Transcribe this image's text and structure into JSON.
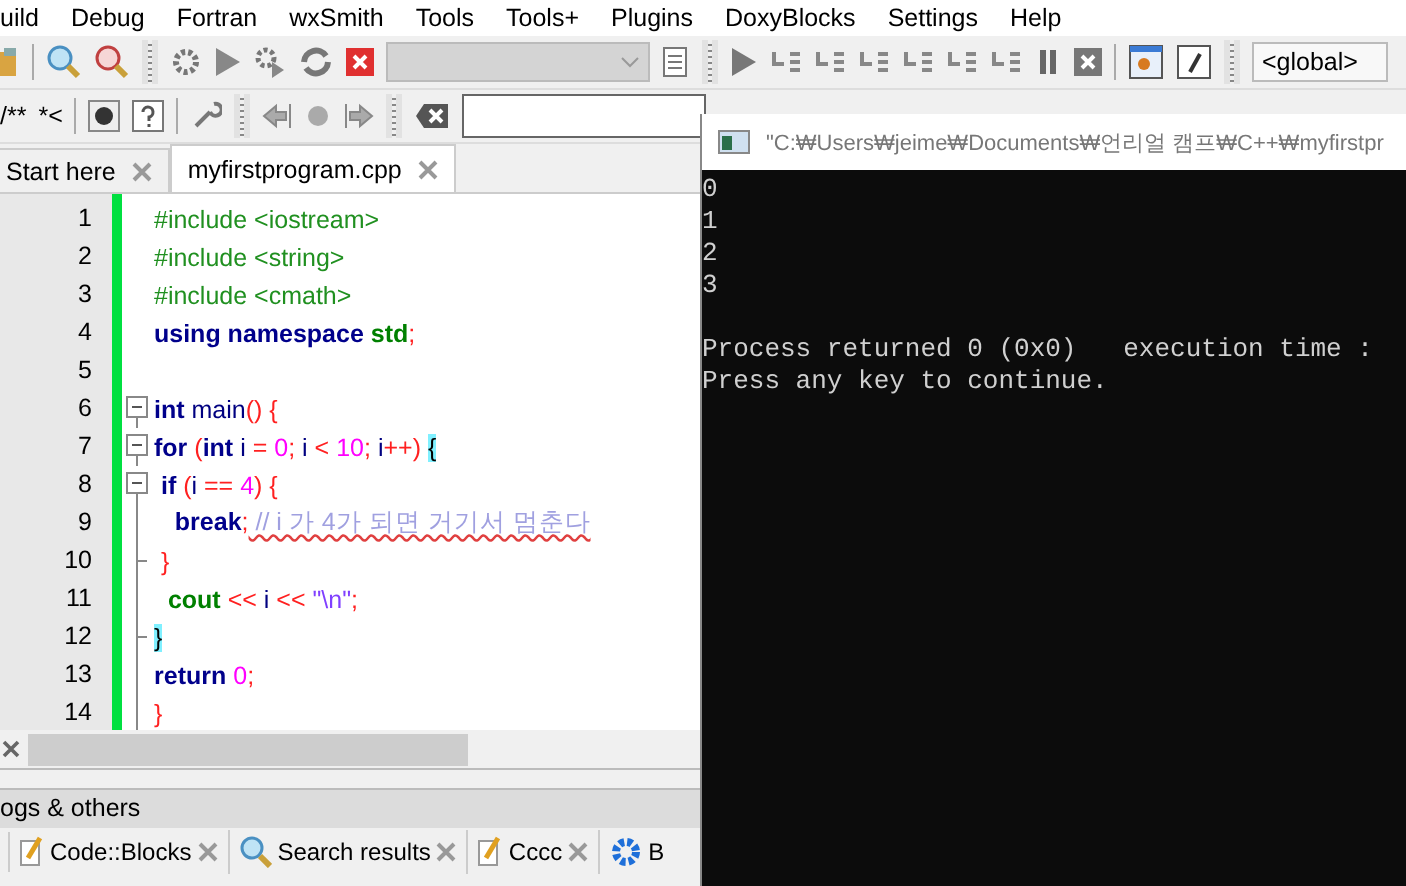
{
  "menu": [
    "uild",
    "Debug",
    "Fortran",
    "wxSmith",
    "Tools",
    "Tools+",
    "Plugins",
    "DoxyBlocks",
    "Settings",
    "Help"
  ],
  "target_dropdown": {
    "disabled": true
  },
  "scope_dropdown": {
    "value": "<global>"
  },
  "comment_buttons": [
    "/**",
    "*<"
  ],
  "editor_tabs": [
    {
      "label": "Start here",
      "selected": false
    },
    {
      "label": "myfirstprogram.cpp",
      "selected": true
    }
  ],
  "code_lines": [
    {
      "number": "1",
      "kind": "plain",
      "tokens": [
        {
          "kind": "preproc",
          "text": "#include <iostream>"
        }
      ]
    },
    {
      "number": "2",
      "kind": "plain",
      "tokens": [
        {
          "kind": "preproc",
          "text": "#include <string>"
        }
      ]
    },
    {
      "number": "3",
      "kind": "plain",
      "tokens": [
        {
          "kind": "preproc",
          "text": "#include <cmath>"
        }
      ]
    },
    {
      "number": "4",
      "kind": "plain",
      "tokens": [
        {
          "kind": "keyword",
          "text": "using namespace "
        },
        {
          "kind": "std",
          "text": "std"
        },
        {
          "kind": "op",
          "text": ";"
        }
      ]
    },
    {
      "number": "5",
      "kind": "plain"
    },
    {
      "number": "6",
      "kind": "fold-start",
      "tokens": [
        {
          "kind": "keyword",
          "text": "int"
        },
        {
          "kind": "plain",
          "text": " main"
        },
        {
          "kind": "op",
          "text": "() {"
        }
      ]
    },
    {
      "number": "7",
      "kind": "fold-start",
      "tokens": [
        {
          "kind": "keyword",
          "text": "for"
        },
        {
          "kind": "op",
          "text": " ("
        },
        {
          "kind": "keyword",
          "text": "int"
        },
        {
          "kind": "plain",
          "text": " i "
        },
        {
          "kind": "op",
          "text": "="
        },
        {
          "kind": "number",
          "text": " 0"
        },
        {
          "kind": "op",
          "text": ";"
        },
        {
          "kind": "plain",
          "text": " i "
        },
        {
          "kind": "op",
          "text": "<"
        },
        {
          "kind": "number",
          "text": " 10"
        },
        {
          "kind": "op",
          "text": ";"
        },
        {
          "kind": "plain",
          "text": " i"
        },
        {
          "kind": "op",
          "text": "++) "
        },
        {
          "kind": "brace",
          "text": "{"
        }
      ]
    },
    {
      "number": "8",
      "kind": "fold-start",
      "tokens": [
        {
          "kind": "keyword",
          "text": " if"
        },
        {
          "kind": "op",
          "text": " ("
        },
        {
          "kind": "plain",
          "text": "i "
        },
        {
          "kind": "op",
          "text": "=="
        },
        {
          "kind": "number",
          "text": " 4"
        },
        {
          "kind": "op",
          "text": ") {"
        }
      ]
    },
    {
      "number": "9",
      "kind": "fold-line",
      "tokens": [
        {
          "kind": "keyword",
          "text": "   break"
        },
        {
          "kind": "op",
          "text": ";"
        },
        {
          "kind": "comment",
          "text": " // i 가 4가 되면 거기서 멈춘다"
        }
      ]
    },
    {
      "number": "10",
      "kind": "fold-end",
      "tokens": [
        {
          "kind": "op",
          "text": " }"
        }
      ]
    },
    {
      "number": "11",
      "kind": "fold-line",
      "tokens": [
        {
          "kind": "std",
          "text": "  cout"
        },
        {
          "kind": "op",
          "text": " << "
        },
        {
          "kind": "plain",
          "text": "i"
        },
        {
          "kind": "op",
          "text": " << "
        },
        {
          "kind": "string",
          "text": "\"\\n\""
        },
        {
          "kind": "op",
          "text": ";"
        }
      ]
    },
    {
      "number": "12",
      "kind": "fold-end",
      "tokens": [
        {
          "kind": "brace",
          "text": "}"
        }
      ]
    },
    {
      "number": "13",
      "kind": "fold-line",
      "tokens": [
        {
          "kind": "keyword",
          "text": "return"
        },
        {
          "kind": "number",
          "text": " 0"
        },
        {
          "kind": "op",
          "text": ";"
        }
      ]
    },
    {
      "number": "14",
      "kind": "fold-line",
      "tokens": [
        {
          "kind": "op",
          "text": "}"
        }
      ]
    }
  ],
  "log_panel": {
    "title": "ogs & others",
    "tabs": [
      {
        "label": "Code::Blocks",
        "kind": "pencil",
        "selected": false,
        "closable": true
      },
      {
        "label": "Search results",
        "kind": "search",
        "selected": false,
        "closable": true
      },
      {
        "label": "Cccc",
        "kind": "pencil",
        "selected": false,
        "closable": true
      },
      {
        "label": "B",
        "kind": "gear",
        "selected": false,
        "closable": false
      }
    ]
  },
  "console": {
    "title": "\"C:₩Users₩jeime₩Documents₩언리얼 캠프₩C++₩myfirstpr",
    "output": [
      [
        "0",
        "1",
        "2",
        "3"
      ],
      [
        "Process returned 0 (0x0)   execution time :",
        "Press any key to continue."
      ]
    ]
  }
}
